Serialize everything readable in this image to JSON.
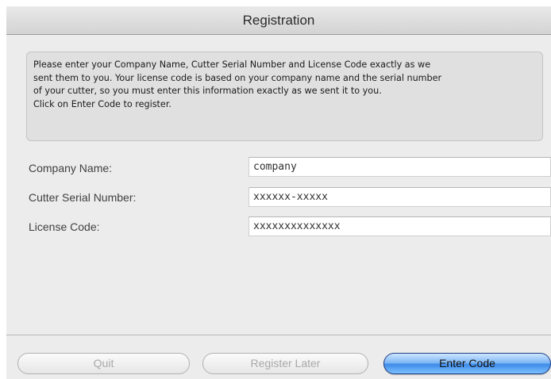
{
  "window": {
    "title": "Registration"
  },
  "info": {
    "text": "Please enter your Company Name, Cutter Serial Number and License Code exactly as we\nsent them to you. Your license code is based on your company name and the serial number\nof your cutter, so you must enter this information exactly as we sent it to you.\nClick on Enter Code to register."
  },
  "fields": {
    "company": {
      "label": "Company Name:",
      "value": "company"
    },
    "serial": {
      "label": "Cutter Serial Number:",
      "value": "xxxxxx-xxxxx"
    },
    "license": {
      "label": "License Code:",
      "value": "xxxxxxxxxxxxxx"
    }
  },
  "buttons": {
    "quit": "Quit",
    "register_later": "Register Later",
    "enter_code": "Enter Code"
  },
  "colors": {
    "window_bg": "#ececec",
    "primary_button": "#3f8be8",
    "disabled_text": "#a9a9a9"
  }
}
